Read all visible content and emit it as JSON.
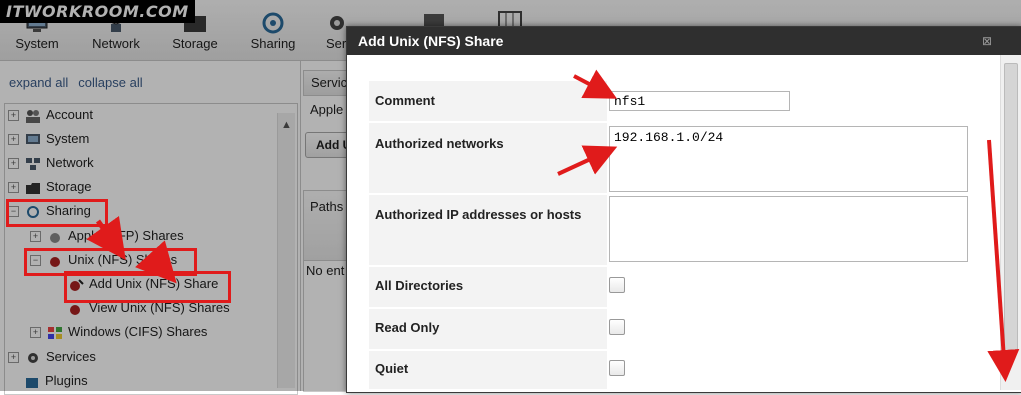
{
  "watermark": "ITWORKROOM.COM",
  "toolbar": {
    "items": [
      {
        "label": "System",
        "icon": "system-icon"
      },
      {
        "label": "Network",
        "icon": "network-icon"
      },
      {
        "label": "Storage",
        "icon": "storage-icon"
      },
      {
        "label": "Sharing",
        "icon": "sharing-icon"
      },
      {
        "label": "Ser",
        "icon": "services-icon"
      }
    ]
  },
  "left": {
    "expand_all": "expand all",
    "collapse_all": "collapse all",
    "tree": [
      {
        "label": "Account"
      },
      {
        "label": "System"
      },
      {
        "label": "Network"
      },
      {
        "label": "Storage"
      },
      {
        "label": "Sharing"
      },
      {
        "label": "Apple (AFP) Shares"
      },
      {
        "label": "Unix (NFS) Shares"
      },
      {
        "label": "Add Unix (NFS) Share"
      },
      {
        "label": "View Unix (NFS) Shares"
      },
      {
        "label": "Windows (CIFS) Shares"
      },
      {
        "label": "Services"
      },
      {
        "label": "Plugins"
      }
    ]
  },
  "middle": {
    "tab": "Servic",
    "crumb": "Apple",
    "add_button": "Add U",
    "grid_header": "Paths",
    "grid_empty": "No ent"
  },
  "dialog": {
    "title": "Add Unix (NFS) Share",
    "fields": {
      "comment": {
        "label": "Comment",
        "value": "nfs1"
      },
      "networks": {
        "label": "Authorized networks",
        "value": "192.168.1.0/24"
      },
      "hosts": {
        "label": "Authorized IP addresses or hosts",
        "value": ""
      },
      "all_dirs": {
        "label": "All Directories",
        "checked": false
      },
      "read_only": {
        "label": "Read Only",
        "checked": false
      },
      "quiet": {
        "label": "Quiet",
        "checked": false
      }
    }
  },
  "colors": {
    "annotation_red": "#e01b1b",
    "dialog_title_bg": "#2f2f2f",
    "link_blue": "#3b5c8a"
  }
}
